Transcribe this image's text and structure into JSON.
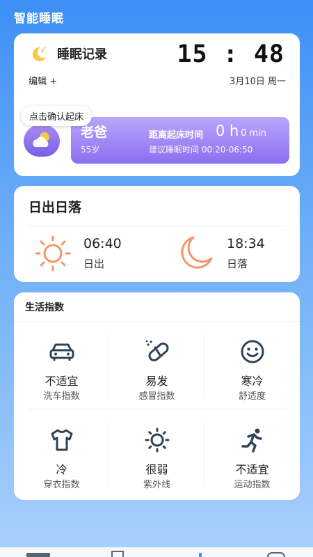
{
  "app": {
    "title": "智能睡眠"
  },
  "sleep": {
    "title": "睡眠记录",
    "clock": "15 : 48",
    "date": "3月10日 周一",
    "edit_label": "编辑 +",
    "tooltip": "点击确认起床",
    "profile": {
      "name": "老爸",
      "age": "55岁",
      "wake_label": "距离起床时间",
      "wake_hours": "0 h",
      "wake_minutes": "0 min",
      "advice": "建议睡眠时间 00:20-06:50"
    }
  },
  "sun": {
    "title": "日出日落",
    "sunrise_time": "06:40",
    "sunrise_label": "日出",
    "sunset_time": "18:34",
    "sunset_label": "日落"
  },
  "index": {
    "title": "生活指数",
    "items": [
      {
        "value": "不适宜",
        "label": "洗车指数",
        "icon": "car-icon"
      },
      {
        "value": "易发",
        "label": "感冒指数",
        "icon": "pill-icon"
      },
      {
        "value": "寒冷",
        "label": "舒适度",
        "icon": "smiley-icon"
      },
      {
        "value": "冷",
        "label": "穿衣指数",
        "icon": "shirt-icon"
      },
      {
        "value": "很弱",
        "label": "紫外线",
        "icon": "sun-icon"
      },
      {
        "value": "不适宜",
        "label": "运动指数",
        "icon": "running-icon"
      }
    ]
  },
  "colors": {
    "accent_blue": "#3d8ff5",
    "sun_orange": "#f4956a",
    "profile_purple": "#8c6ef0",
    "index_icon": "#2f4256"
  }
}
